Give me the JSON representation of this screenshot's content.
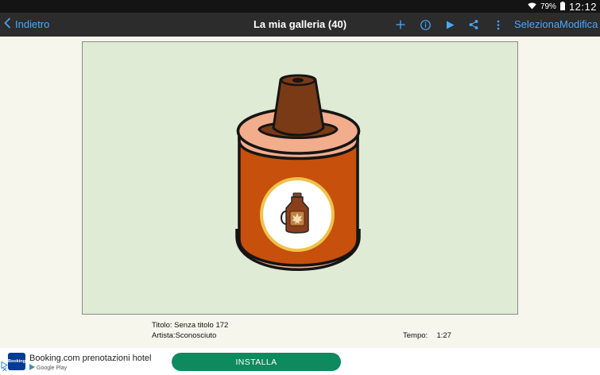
{
  "status_bar": {
    "battery": "79%",
    "time": "12:12",
    "icons": [
      "wifi-icon",
      "battery-icon"
    ]
  },
  "nav": {
    "back_label": "Indietro",
    "title": "La mia galleria (40)",
    "select_label": "Seleziona",
    "edit_label": "Modifica",
    "icons": [
      "plus-icon",
      "info-icon",
      "play-icon",
      "share-icon",
      "more-vert-icon"
    ],
    "accent": "#4aa8ff"
  },
  "artwork": {
    "background": "#dfebd5",
    "subject": "syrup-dispenser-drawing"
  },
  "details": {
    "title_label": "Titolo:",
    "title_value": "Senza titolo 172",
    "artist_label": "Artista:",
    "artist_value": "Sconosciuto",
    "time_label": "Tempo:",
    "time_value": "1:27"
  },
  "ad": {
    "logo_text": "Booking",
    "title": "Booking.com prenotazioni hotel",
    "store": "Google Play",
    "install_label": "INSTALLA",
    "install_color": "#0f8a5e"
  }
}
